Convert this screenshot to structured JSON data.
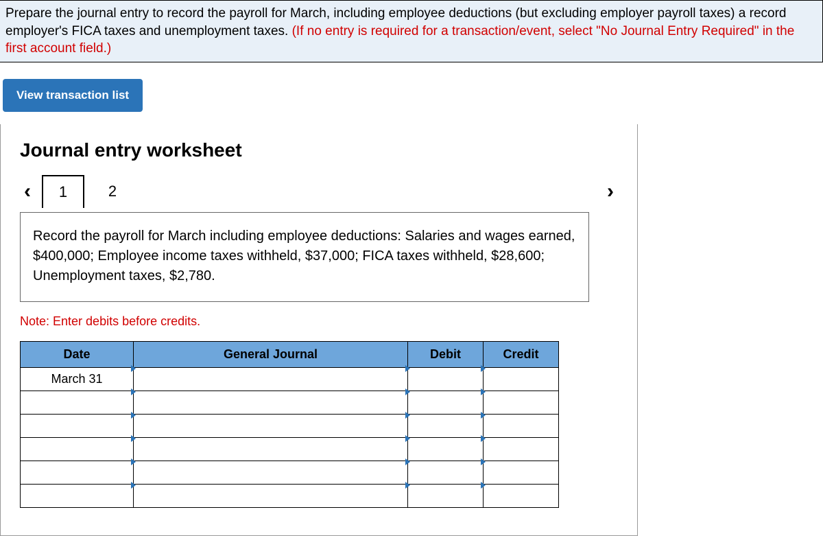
{
  "instructions": {
    "part1": "Prepare the journal entry to record the payroll for March, including employee deductions (but excluding employer payroll taxes) a record employer's FICA taxes and unemployment taxes. ",
    "part2": "(If no entry is required for a transaction/event, select \"No Journal Entry Required\" in the first account field.)"
  },
  "view_button": "View transaction list",
  "worksheet": {
    "title": "Journal entry worksheet",
    "tabs": [
      "1",
      "2"
    ],
    "active_tab": 0,
    "description": "Record the payroll for March including employee deductions: Salaries and wages earned, $400,000; Employee income taxes withheld, $37,000; FICA taxes withheld, $28,600; Unemployment taxes, $2,780.",
    "note": "Note: Enter debits before credits.",
    "table": {
      "headers": {
        "date": "Date",
        "gj": "General Journal",
        "debit": "Debit",
        "credit": "Credit"
      },
      "rows": [
        {
          "date": "March 31",
          "gj": "",
          "debit": "",
          "credit": ""
        },
        {
          "date": "",
          "gj": "",
          "debit": "",
          "credit": ""
        },
        {
          "date": "",
          "gj": "",
          "debit": "",
          "credit": ""
        },
        {
          "date": "",
          "gj": "",
          "debit": "",
          "credit": ""
        },
        {
          "date": "",
          "gj": "",
          "debit": "",
          "credit": ""
        },
        {
          "date": "",
          "gj": "",
          "debit": "",
          "credit": ""
        }
      ]
    }
  }
}
